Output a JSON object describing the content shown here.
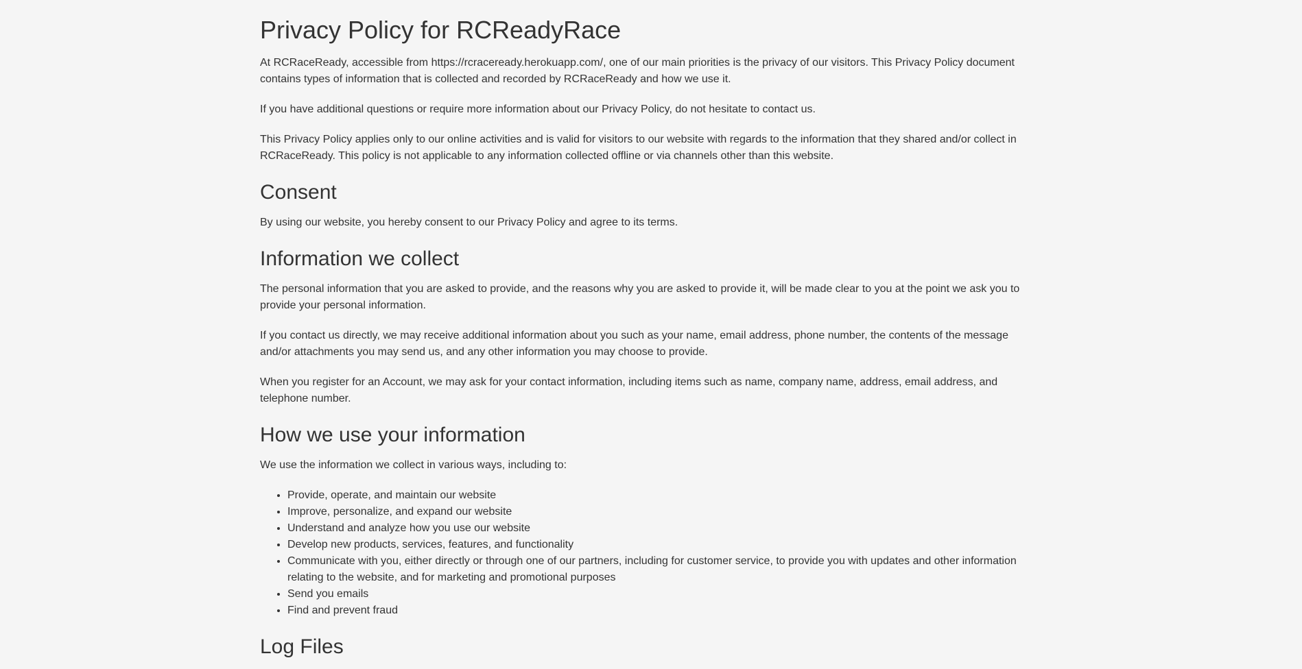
{
  "title": "Privacy Policy for RCReadyRace",
  "intro": [
    "At RCRaceReady, accessible from https://rcraceready.herokuapp.com/, one of our main priorities is the privacy of our visitors. This Privacy Policy document contains types of information that is collected and recorded by RCRaceReady and how we use it.",
    "If you have additional questions or require more information about our Privacy Policy, do not hesitate to contact us.",
    "This Privacy Policy applies only to our online activities and is valid for visitors to our website with regards to the information that they shared and/or collect in RCRaceReady. This policy is not applicable to any information collected offline or via channels other than this website."
  ],
  "consent": {
    "heading": "Consent",
    "text": "By using our website, you hereby consent to our Privacy Policy and agree to its terms."
  },
  "collect": {
    "heading": "Information we collect",
    "paragraphs": [
      "The personal information that you are asked to provide, and the reasons why you are asked to provide it, will be made clear to you at the point we ask you to provide your personal information.",
      "If you contact us directly, we may receive additional information about you such as your name, email address, phone number, the contents of the message and/or attachments you may send us, and any other information you may choose to provide.",
      "When you register for an Account, we may ask for your contact information, including items such as name, company name, address, email address, and telephone number."
    ]
  },
  "use": {
    "heading": "How we use your information",
    "intro": "We use the information we collect in various ways, including to:",
    "items": [
      "Provide, operate, and maintain our website",
      "Improve, personalize, and expand our website",
      "Understand and analyze how you use our website",
      "Develop new products, services, features, and functionality",
      "Communicate with you, either directly or through one of our partners, including for customer service, to provide you with updates and other information relating to the website, and for marketing and promotional purposes",
      "Send you emails",
      "Find and prevent fraud"
    ]
  },
  "logfiles": {
    "heading": "Log Files"
  }
}
